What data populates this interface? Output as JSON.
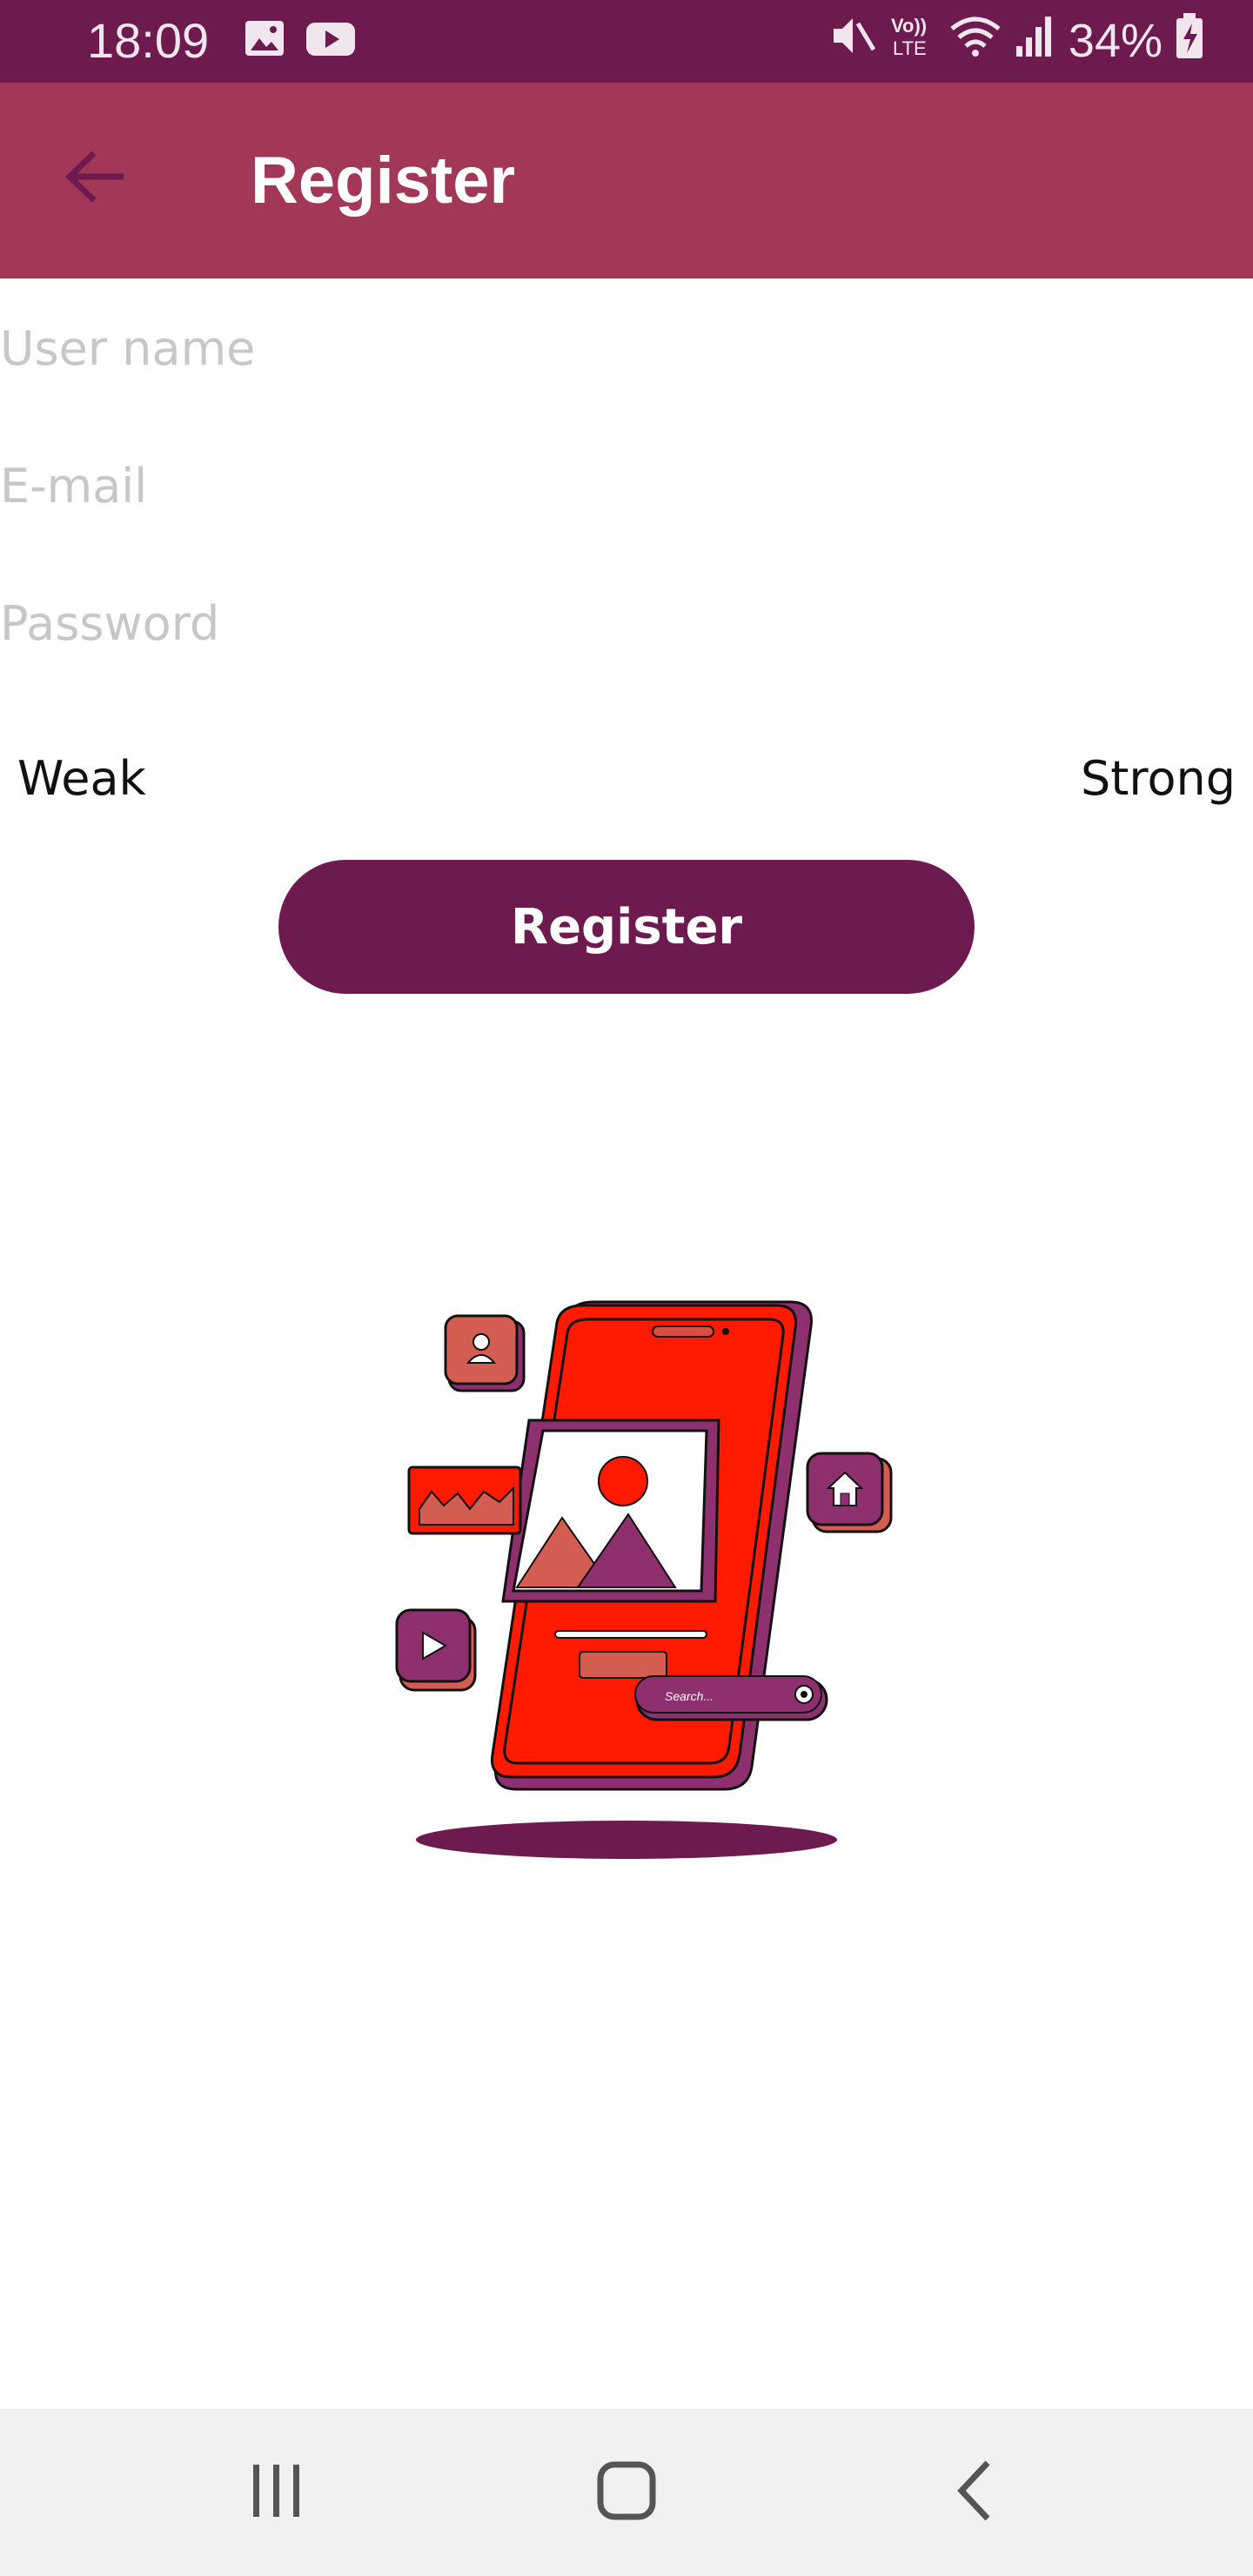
{
  "status_bar": {
    "time": "18:09",
    "battery": "34%",
    "icons": [
      "image-icon",
      "youtube-icon",
      "mute-icon",
      "volte-icon",
      "wifi-icon",
      "signal-icon",
      "battery-charging-icon"
    ],
    "network_label": "VoLTE"
  },
  "app_bar": {
    "title": "Register",
    "back_icon": "arrow-back-icon",
    "color": "#a23757"
  },
  "form": {
    "username_placeholder": "User name",
    "email_placeholder": "E-mail",
    "password_placeholder": "Password",
    "strength_weak": "Weak",
    "strength_strong": "Strong",
    "register_label": "Register",
    "button_color": "#6d1a4f"
  },
  "illustration": {
    "search_placeholder": "Search..."
  },
  "nav_bar": {
    "recents_icon": "recents-icon",
    "home_icon": "home-icon",
    "back_icon": "back-icon"
  },
  "colors": {
    "status_bar": "#6d1a4f",
    "accent_red": "#ff1a00"
  }
}
